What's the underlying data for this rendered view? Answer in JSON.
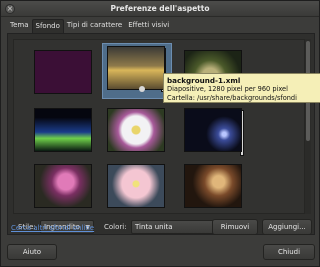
{
  "window": {
    "title": "Preferenze dell'aspetto"
  },
  "tabs": [
    {
      "label": "Tema"
    },
    {
      "label": "Sfondo"
    },
    {
      "label": "Tipi di carattere"
    },
    {
      "label": "Effetti visivi"
    }
  ],
  "tooltip": {
    "title": "background-1.xml",
    "line1": "Diapositive, 1280 pixel per 960 pixel",
    "line2": "Cartella: /usr/share/backgrounds/sfondi"
  },
  "controls": {
    "style_label": "Stile:",
    "style_value": "Ingrandito",
    "colors_label": "Colori:",
    "colors_value": "Tinta unita",
    "swatch_color": "#3b0f36"
  },
  "footer": {
    "link_text": "Cerca altri sfondi online",
    "remove_label": "Rimuovi",
    "add_label": "Aggiungi...",
    "help_label": "Aiuto",
    "close_label": "Chiudi"
  },
  "icons": {
    "close": "close-icon",
    "dropdown": "chevron-down-icon"
  }
}
